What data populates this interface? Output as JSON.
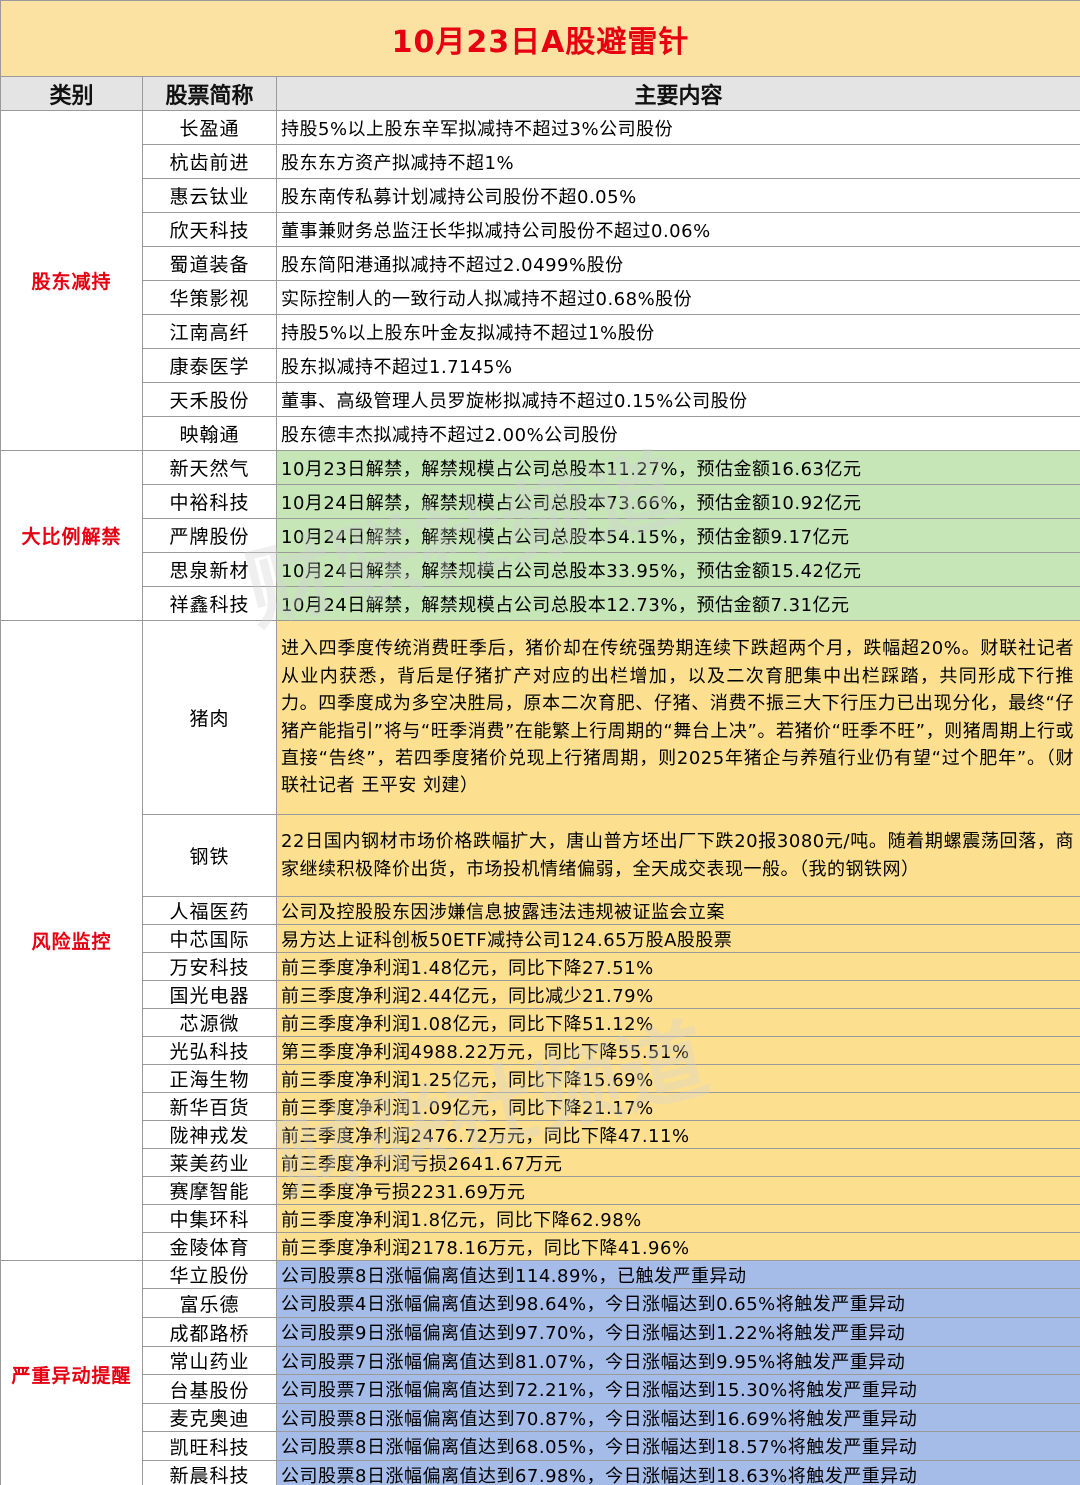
{
  "title": "10月23日A股避雷针",
  "columns": {
    "category": "类别",
    "stock": "股票简称",
    "content": "主要内容"
  },
  "colors": {
    "title_bg": "#fbe1a2",
    "title_text": "#e60012",
    "category_text": "#e60012",
    "green": "#c6e6b8",
    "yellow": "#fde08f",
    "blue": "#a5bbe8"
  },
  "watermark_text": "财联社频道",
  "sections": [
    {
      "category": "股东减持",
      "rows": [
        {
          "name": "长盈通",
          "content": "持股5%以上股东辛军拟减持不超过3%公司股份"
        },
        {
          "name": "杭齿前进",
          "content": "股东东方资产拟减持不超1%"
        },
        {
          "name": "惠云钛业",
          "content": "股东南传私募计划减持公司股份不超0.05%"
        },
        {
          "name": "欣天科技",
          "content": "董事兼财务总监汪长华拟减持公司股份不超过0.06%"
        },
        {
          "name": "蜀道装备",
          "content": "股东简阳港通拟减持不超过2.0499%股份"
        },
        {
          "name": "华策影视",
          "content": "实际控制人的一致行动人拟减持不超过0.68%股份"
        },
        {
          "name": "江南高纤",
          "content": "持股5%以上股东叶金友拟减持不超过1%股份"
        },
        {
          "name": "康泰医学",
          "content": "股东拟减持不超过1.7145%"
        },
        {
          "name": "天禾股份",
          "content": "董事、高级管理人员罗旋彬拟减持不超过0.15%公司股份"
        },
        {
          "name": "映翰通",
          "content": "股东德丰杰拟减持不超过2.00%公司股份"
        }
      ]
    },
    {
      "category": "大比例解禁",
      "rows": [
        {
          "name": "新天然气",
          "content": "10月23日解禁，解禁规模占公司总股本11.27%，预估金额16.63亿元"
        },
        {
          "name": "中裕科技",
          "content": "10月24日解禁，解禁规模占公司总股本73.66%，预估金额10.92亿元"
        },
        {
          "name": "严牌股份",
          "content": "10月24日解禁，解禁规模占公司总股本54.15%，预估金额9.17亿元"
        },
        {
          "name": "思泉新材",
          "content": "10月24日解禁，解禁规模占公司总股本33.95%，预估金额15.42亿元"
        },
        {
          "name": "祥鑫科技",
          "content": "10月24日解禁，解禁规模占公司总股本12.73%，预估金额7.31亿元"
        }
      ]
    },
    {
      "category": "风险监控",
      "rows": [
        {
          "name": "猪肉",
          "content": "进入四季度传统消费旺季后，猪价却在传统强势期连续下跌超两个月，跌幅超20%。财联社记者从业内获悉，背后是仔猪扩产对应的出栏增加，以及二次育肥集中出栏踩踏，共同形成下行推力。四季度成为多空决胜局，原本二次育肥、仔猪、消费不振三大下行压力已出现分化，最终“仔猪产能指引”将与“旺季消费”在能繁上行周期的“舞台上决”。若猪价“旺季不旺”，则猪周期上行或直接“告终”，若四季度猪价兑现上行猪周期，则2025年猪企与养殖行业仍有望“过个肥年”。（财联社记者 王平安 刘建）"
        },
        {
          "name": "钢铁",
          "content": "22日国内钢材市场价格跌幅扩大，唐山普方坯出厂下跌20报3080元/吨。随着期螺震荡回落，商家继续积极降价出货，市场投机情绪偏弱，全天成交表现一般。（我的钢铁网）"
        },
        {
          "name": "人福医药",
          "content": "公司及控股股东因涉嫌信息披露违法违规被证监会立案"
        },
        {
          "name": "中芯国际",
          "content": "易方达上证科创板50ETF减持公司124.65万股A股股票"
        },
        {
          "name": "万安科技",
          "content": "前三季度净利润1.48亿元，同比下降27.51%"
        },
        {
          "name": "国光电器",
          "content": "前三季度净利润2.44亿元，同比减少21.79%"
        },
        {
          "name": "芯源微",
          "content": "前三季度净利润1.08亿元，同比下降51.12%"
        },
        {
          "name": "光弘科技",
          "content": "第三季度净利润4988.22万元，同比下降55.51%"
        },
        {
          "name": "正海生物",
          "content": "前三季度净利润1.25亿元，同比下降15.69%"
        },
        {
          "name": "新华百货",
          "content": "前三季度净利润1.09亿元，同比下降21.17%"
        },
        {
          "name": "陇神戎发",
          "content": "前三季度净利润2476.72万元，同比下降47.11%"
        },
        {
          "name": "莱美药业",
          "content": "前三季度净利润亏损2641.67万元"
        },
        {
          "name": "赛摩智能",
          "content": "第三季度净亏损2231.69万元"
        },
        {
          "name": "中集环科",
          "content": "前三季度净利润1.8亿元，同比下降62.98%"
        },
        {
          "name": "金陵体育",
          "content": "前三季度净利润2178.16万元，同比下降41.96%"
        }
      ]
    },
    {
      "category": "严重异动提醒",
      "rows": [
        {
          "name": "华立股份",
          "content": "公司股票8日涨幅偏离值达到114.89%，已触发严重异动"
        },
        {
          "name": "富乐德",
          "content": "公司股票4日涨幅偏离值达到98.64%，今日涨幅达到0.65%将触发严重异动"
        },
        {
          "name": "成都路桥",
          "content": "公司股票9日涨幅偏离值达到97.70%，今日涨幅达到1.22%将触发严重异动"
        },
        {
          "name": "常山药业",
          "content": "公司股票7日涨幅偏离值达到81.07%，今日涨幅达到9.95%将触发严重异动"
        },
        {
          "name": "台基股份",
          "content": "公司股票7日涨幅偏离值达到72.21%，今日涨幅达到15.30%将触发严重异动"
        },
        {
          "name": "麦克奥迪",
          "content": "公司股票8日涨幅偏离值达到70.87%，今日涨幅达到16.69%将触发严重异动"
        },
        {
          "name": "凯旺科技",
          "content": "公司股票8日涨幅偏离值达到68.05%，今日涨幅达到18.57%将触发严重异动"
        },
        {
          "name": "新晨科技",
          "content": "公司股票8日涨幅偏离值达到67.98%，今日涨幅达到18.63%将触发严重异动"
        }
      ]
    }
  ]
}
